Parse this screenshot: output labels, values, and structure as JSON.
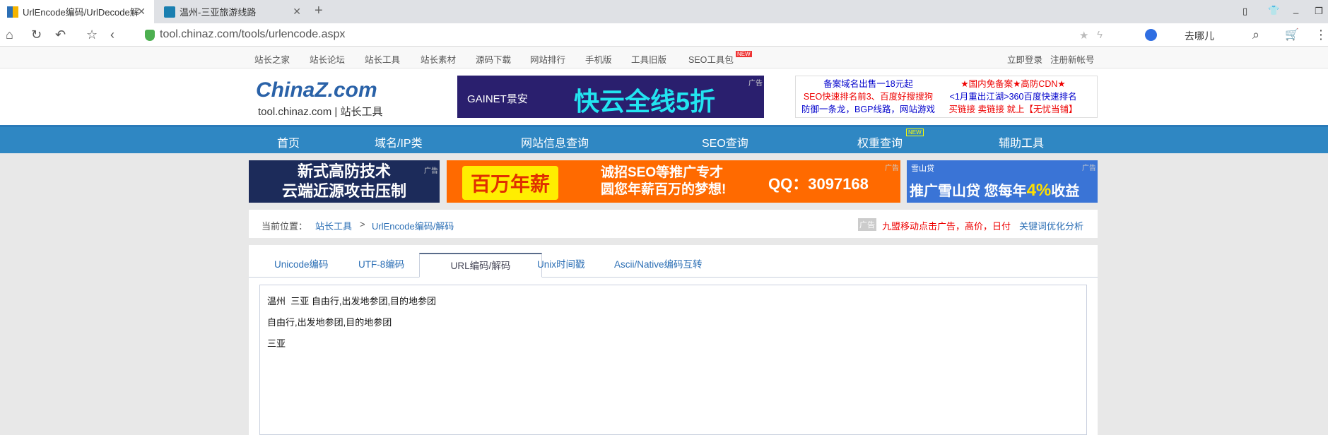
{
  "browser": {
    "tabs": [
      {
        "title": "UrlEncode编码/UrlDecode解"
      },
      {
        "title": "温州-三亚旅游线路"
      }
    ],
    "url": "tool.chinaz.com/tools/urlencode.aspx",
    "search_label": "去哪儿"
  },
  "topnav": {
    "items": [
      "站长之家",
      "站长论坛",
      "站长工具",
      "站长素材",
      "源码下载",
      "网站排行",
      "手机版",
      "工具旧版",
      "SEO工具包"
    ],
    "new_badge": "NEW",
    "login": "立即登录",
    "register": "注册新帐号"
  },
  "header": {
    "logo": "ChinaZ.com",
    "logo_sub": "tool.chinaz.com | 站长工具",
    "ad_banner": "快云全线5折",
    "ad_brand": "GAINET景安",
    "ad_tag": "广告",
    "text_ads": [
      [
        "备案域名出售一18元起",
        "SEO快速排名前3、百度好搜搜狗",
        "防御一条龙，BGP线路，网站游戏"
      ],
      [
        "★国内免备案★高防CDN★",
        "<1月重出江湖>360百度快速排名",
        "买链接 卖链接 就上【无忧当铺】"
      ]
    ]
  },
  "mainnav": {
    "items": [
      "首页",
      "域名/IP类",
      "网站信息查询",
      "SEO查询",
      "权重查询",
      "辅助工具"
    ],
    "new_badge": "NEW"
  },
  "ads": {
    "a1": [
      "新式高防技术",
      "云端近源攻击压制"
    ],
    "a2_left": "百万年薪",
    "a2_mid": [
      "诚招SEO等推广专才",
      "圆您年薪百万的梦想!"
    ],
    "a2_qq": "QQ：3097168",
    "a3_brand": "雪山贷",
    "a3_text": "推广雪山贷 您每年",
    "a3_pct": "4%",
    "a3_end": "收益",
    "tag": "广告"
  },
  "breadcrumb": {
    "label": "当前位置：",
    "home": "站长工具",
    "sep": ">",
    "current": "UrlEncode编码/解码",
    "ad_tag": "广告",
    "ad_text": "九盟移动点击广告，高价，日付",
    "link": "关键词优化分析"
  },
  "tool": {
    "tabs": [
      "Unicode编码",
      "UTF-8编码",
      "URL编码/解码",
      "Unix时间戳",
      "Ascii/Native编码互转"
    ],
    "active_tab": 2,
    "lines": [
      "温州  三亚 自由行,出发地参团,目的地参团",
      "自由行,出发地参团,目的地参团",
      "三亚"
    ]
  }
}
